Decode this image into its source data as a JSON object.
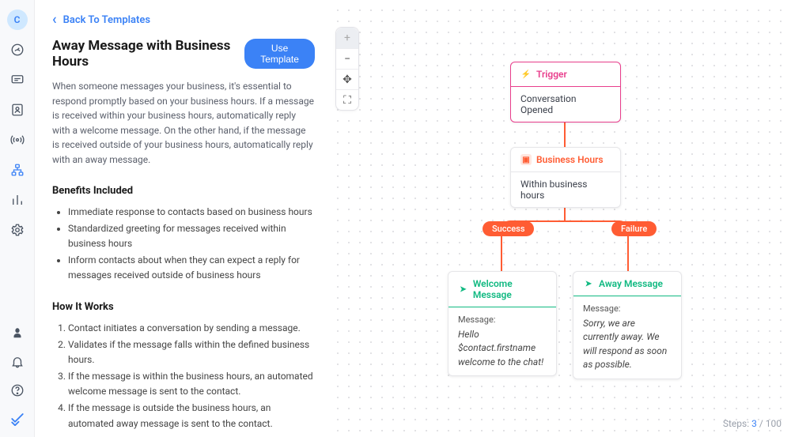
{
  "sidebar": {
    "avatar_letter": "C"
  },
  "panel": {
    "back_label": "Back To Templates",
    "title": "Away Message with Business Hours",
    "use_template_label": "Use Template",
    "description": "When someone messages your business, it's essential to respond promptly based on your business hours. If a message is received within your business hours, automatically reply with a welcome message. On the other hand, if the message is received outside of your business hours, automatically reply with an away message.",
    "benefits_heading": "Benefits Included",
    "benefits": [
      "Immediate response to contacts based on business hours",
      "Standardized greeting for messages received within business hours",
      "Inform contacts about when they can expect a reply for messages received outside of business hours"
    ],
    "how_heading": "How It Works",
    "how": [
      "Contact initiates a conversation by sending a message.",
      "Validates if the message falls within the defined business hours.",
      "If the message is within the business hours, an automated welcome message is sent to the contact.",
      "If the message is outside the business hours, an automated away message is sent to the contact."
    ]
  },
  "workflow": {
    "trigger": {
      "title": "Trigger",
      "subtitle": "Conversation Opened"
    },
    "business_hours": {
      "title": "Business Hours",
      "subtitle": "Within business hours"
    },
    "branches": {
      "success_label": "Success",
      "failure_label": "Failure"
    },
    "welcome": {
      "title": "Welcome Message",
      "msg_label": "Message:",
      "msg_value": "Hello $contact.firstname welcome to the chat!"
    },
    "away": {
      "title": "Away Message",
      "msg_label": "Message:",
      "msg_value": "Sorry, we are currently away. We will respond as soon as possible."
    }
  },
  "footer": {
    "steps_label": "Steps: ",
    "steps_current": "3",
    "steps_sep": " / ",
    "steps_max": "100"
  }
}
